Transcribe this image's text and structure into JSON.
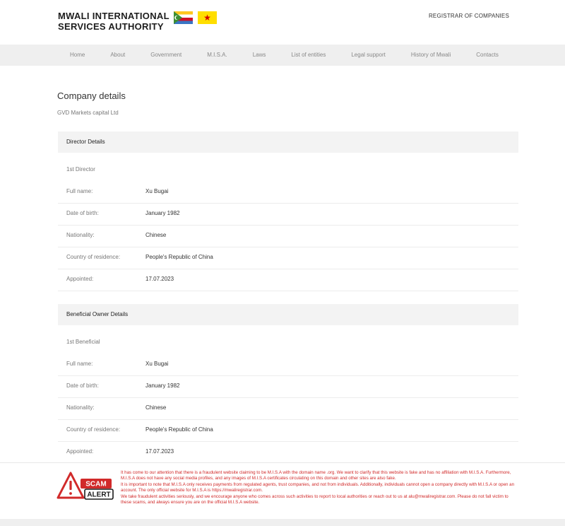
{
  "header": {
    "org_name": "MWALI INTERNATIONAL SERVICES AUTHORITY",
    "registrar_link": "REGISTRAR OF COMPANIES"
  },
  "nav": {
    "items": [
      "Home",
      "About",
      "Government",
      "M.I.S.A.",
      "Laws",
      "List of entities",
      "Legal support",
      "History of Mwali",
      "Contacts"
    ]
  },
  "page": {
    "title": "Company details",
    "company_name": "GVD Markets capital Ltd"
  },
  "director": {
    "section_title": "Director Details",
    "sub_label": "1st Director",
    "rows": [
      {
        "label": "Full name:",
        "value": "Xu Bugai"
      },
      {
        "label": "Date of birth:",
        "value": "January 1982"
      },
      {
        "label": "Nationality:",
        "value": "Chinese"
      },
      {
        "label": "Country of residence:",
        "value": "People's Republic of China"
      },
      {
        "label": "Appointed:",
        "value": "17.07.2023"
      }
    ]
  },
  "beneficial": {
    "section_title": "Beneficial Owner Details",
    "sub_label": "1st Beneficial",
    "rows": [
      {
        "label": "Full name:",
        "value": "Xu Bugai"
      },
      {
        "label": "Date of birth:",
        "value": "January 1982"
      },
      {
        "label": "Nationality:",
        "value": "Chinese"
      },
      {
        "label": "Country of residence:",
        "value": "People's Republic of China"
      },
      {
        "label": "Appointed:",
        "value": "17.07.2023"
      }
    ]
  },
  "scam_alert": {
    "badge_line1": "SCAM",
    "badge_line2": "ALERT",
    "paragraph1": "It has come to our attention that there is a fraudulent website claiming to be M.I.S.A with the domain name .org. We want to clarify that this website is fake and has no affiliation with M.I.S.A. Furthermore, M.I.S.A does not have any social media profiles, and any images of M.I.S.A certificates circulating on this domain and other sites are also fake.",
    "paragraph2": "It is important to note that M.I.S.A only receives payments from regulated agents, trust companies, and not from individuals. Additionally, individuals cannot open a company directly with M.I.S.A or open an account. The only official website for M.I.S.A is https://mwaliregistrar.com.",
    "paragraph3": "We take fraudulent activities seriously, and we encourage anyone who comes across such activities to report to local authorities or reach out to us at alu@mwaliregistrar.com. Please do not fall victim to these scams, and always ensure you are on the official M.I.S.A website."
  },
  "colors": {
    "alert_red": "#d12a2a",
    "nav_bg": "#efefef",
    "section_bg": "#f3f3f3"
  }
}
